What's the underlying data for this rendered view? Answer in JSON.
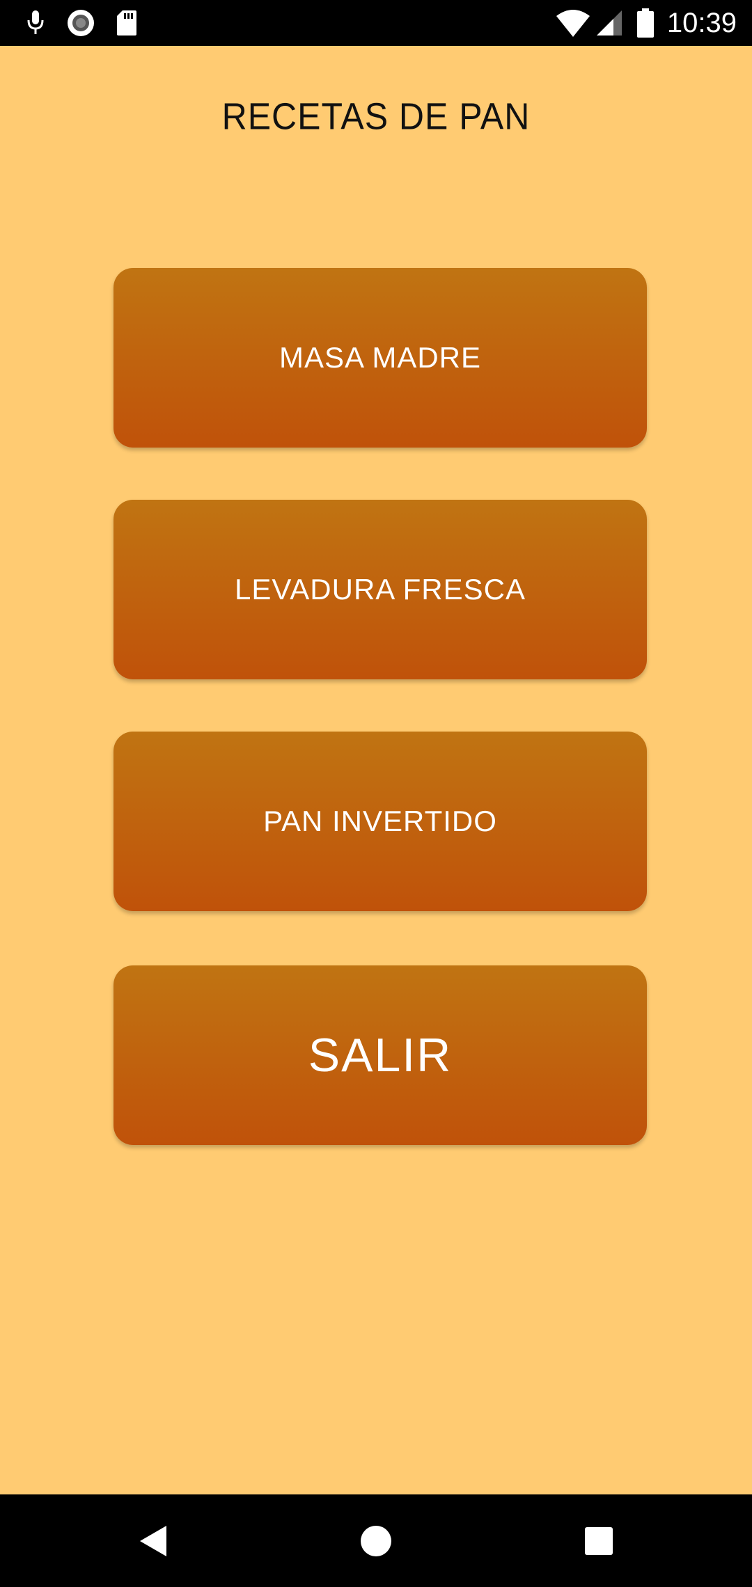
{
  "status_bar": {
    "time": "10:39",
    "icons": [
      "microphone-icon",
      "record-icon",
      "sd-card-icon",
      "wifi-icon",
      "cell-signal-icon",
      "battery-icon"
    ]
  },
  "screen": {
    "title": "RECETAS DE PAN",
    "background_color": "#FFCB72",
    "button_gradient": [
      "#C07412",
      "#C0520A"
    ]
  },
  "buttons": {
    "masa_madre": "MASA MADRE",
    "levadura_fresca": "LEVADURA FRESCA",
    "pan_invertido": "PAN INVERTIDO",
    "salir": "SALIR"
  },
  "nav_bar": {
    "icons": [
      "back-icon",
      "home-icon",
      "recents-icon"
    ]
  }
}
